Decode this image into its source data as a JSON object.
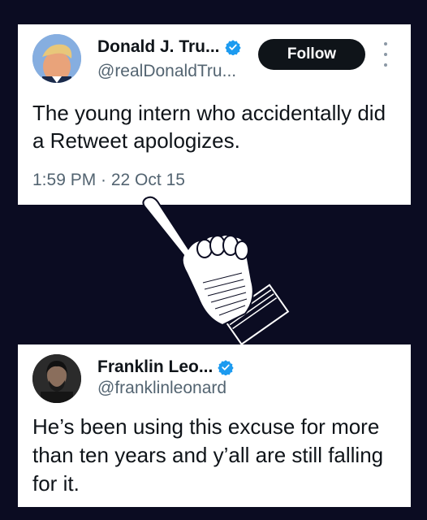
{
  "tweets": [
    {
      "author_name": "Donald J. Tru...",
      "handle": "@realDonaldTru...",
      "follow_label": "Follow",
      "text": "The young intern who accidentally did a Retweet apologizes.",
      "timestamp": "1:59 PM · 22 Oct 15",
      "verified": true
    },
    {
      "author_name": "Franklin Leo...",
      "handle": "@franklinleonard",
      "text": "He’s been using this excuse for more than ten years and y’all are still falling for it.",
      "verified": true
    }
  ],
  "colors": {
    "background": "#0b0c22",
    "card": "#ffffff",
    "verified_badge": "#1d9bf0",
    "follow_button": "#0f1419"
  },
  "icons": [
    "verified-badge-icon",
    "more-options-icon",
    "pointing-hand-icon"
  ]
}
